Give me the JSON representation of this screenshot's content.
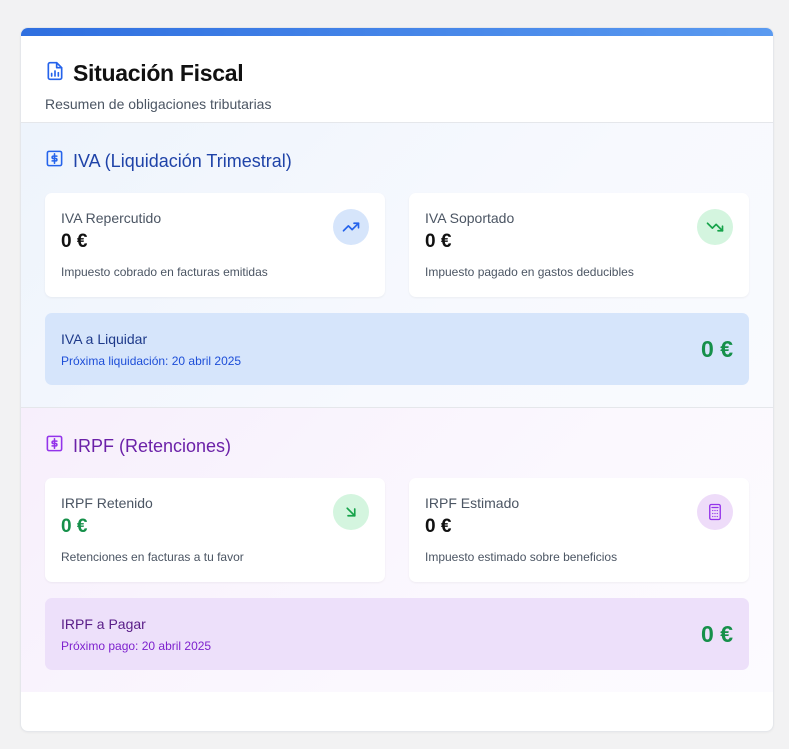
{
  "header": {
    "title": "Situación Fiscal",
    "subtitle": "Resumen de obligaciones tributarias",
    "icon": "file-chart-icon",
    "accent": "#2f6fe0"
  },
  "iva": {
    "title": "IVA (Liquidación Trimestral)",
    "icon": "dollar-square-icon",
    "color": "#1f43a8",
    "cards": [
      {
        "label": "IVA Repercutido",
        "value": "0 €",
        "desc": "Impuesto cobrado en facturas emitidas",
        "icon": "trending-up-icon"
      },
      {
        "label": "IVA Soportado",
        "value": "0 €",
        "desc": "Impuesto pagado en gastos deducibles",
        "icon": "trending-down-icon"
      }
    ],
    "summary": {
      "label": "IVA a Liquidar",
      "sub": "Próxima liquidación: 20 abril 2025",
      "value": "0 €"
    }
  },
  "irpf": {
    "title": "IRPF (Retenciones)",
    "icon": "dollar-square-icon",
    "color": "#6b21a8",
    "cards": [
      {
        "label": "IRPF Retenido",
        "value": "0 €",
        "desc": "Retenciones en facturas a tu favor",
        "icon": "arrow-down-right-icon"
      },
      {
        "label": "IRPF Estimado",
        "value": "0 €",
        "desc": "Impuesto estimado sobre beneficios",
        "icon": "calculator-icon"
      }
    ],
    "summary": {
      "label": "IRPF a Pagar",
      "sub": "Próximo pago: 20 abril 2025",
      "value": "0 €"
    }
  }
}
